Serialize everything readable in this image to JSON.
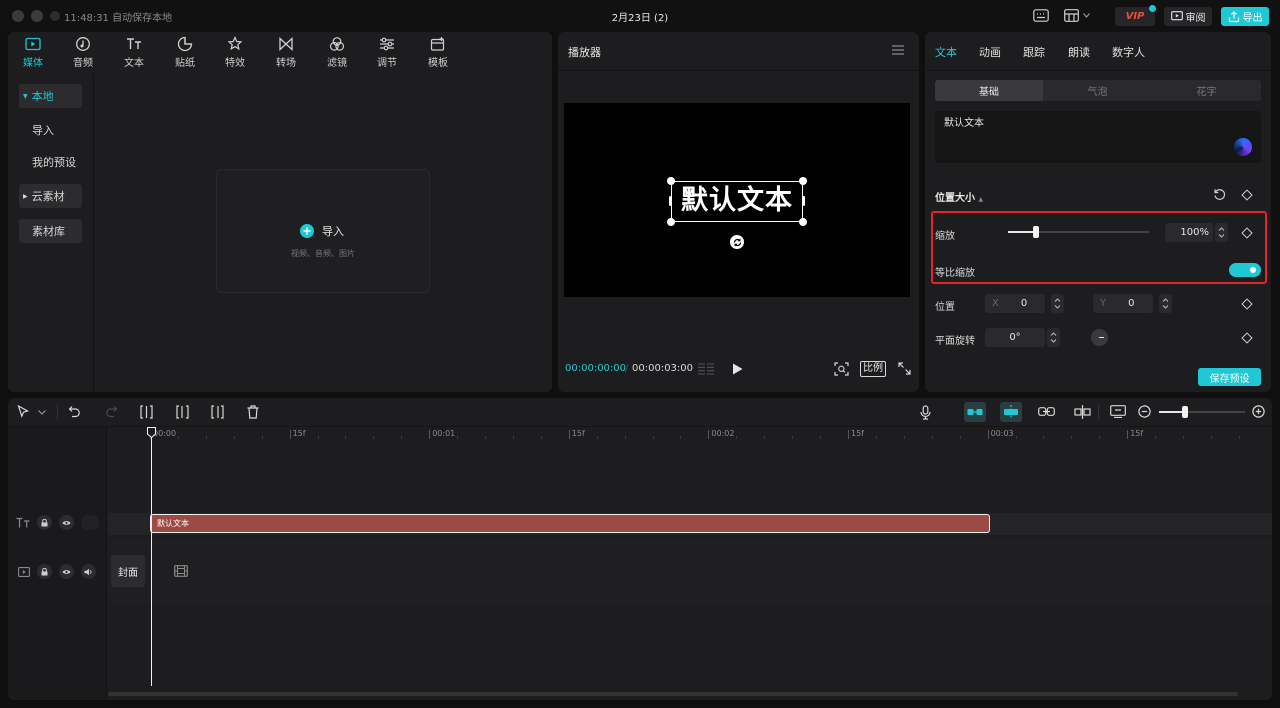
{
  "titlebar": {
    "status": "11:48:31 自动保存本地",
    "title": "2月23日 (2)",
    "vip_label": "VIP",
    "review_label": "审阅",
    "export_label": "导出"
  },
  "media_toolbar": [
    {
      "label": "媒体",
      "icon": "media-icon"
    },
    {
      "label": "音频",
      "icon": "audio-icon"
    },
    {
      "label": "文本",
      "icon": "text-icon"
    },
    {
      "label": "贴纸",
      "icon": "sticker-icon"
    },
    {
      "label": "特效",
      "icon": "effects-icon"
    },
    {
      "label": "转场",
      "icon": "transition-icon"
    },
    {
      "label": "滤镜",
      "icon": "filter-icon"
    },
    {
      "label": "调节",
      "icon": "adjust-icon"
    },
    {
      "label": "模板",
      "icon": "template-icon"
    }
  ],
  "media_sidebar": {
    "local": "本地",
    "import": "导入",
    "my_presets": "我的预设",
    "cloud": "云素材",
    "library": "素材库"
  },
  "import_box": {
    "label": "导入",
    "hint": "视频、音频、图片"
  },
  "player": {
    "title": "播放器",
    "canvas_text": "默认文本",
    "current_time": "00:00:00:00",
    "total_time": "00:00:03:00",
    "ratio_label": "比例"
  },
  "props": {
    "tabs": [
      "文本",
      "动画",
      "跟踪",
      "朗读",
      "数字人"
    ],
    "subtabs": [
      "基础",
      "气泡",
      "花字"
    ],
    "text_value": "默认文本",
    "section_title": "位置大小",
    "scale_label": "缩放",
    "scale_value": "100%",
    "scale_fraction": 0.2,
    "uniform_scale_label": "等比缩放",
    "uniform_scale_on": true,
    "position_label": "位置",
    "x_label": "X",
    "x_value": "0",
    "y_label": "Y",
    "y_value": "0",
    "rotation_label": "平面旋转",
    "rotation_value": "0°",
    "save_preset": "保存预设"
  },
  "timeline": {
    "ruler": [
      "00:00",
      "15f",
      "00:01",
      "15f",
      "00:02",
      "15f",
      "00:03",
      "15f"
    ],
    "text_clip_label": "默认文本",
    "cover_label": "封面",
    "zoom_fraction": 0.3
  },
  "colors": {
    "accent": "#1ec9d5",
    "clip": "#9e4a44",
    "highlight": "#e0262b"
  }
}
